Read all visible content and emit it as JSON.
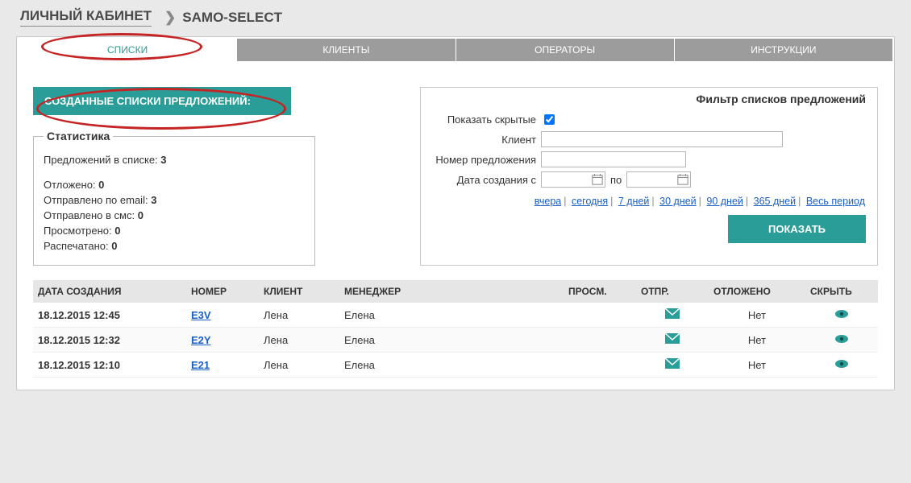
{
  "breadcrumb": {
    "home": "ЛИЧНЫЙ КАБИНЕТ",
    "current": "SAMO-SELECT"
  },
  "tabs": [
    "СПИСКИ",
    "КЛИЕНТЫ",
    "ОПЕРАТОРЫ",
    "ИНСТРУКЦИИ"
  ],
  "panel_title": "СОЗДАННЫЕ СПИСКИ ПРЕДЛОЖЕНИЙ:",
  "stats": {
    "legend": "Статистика",
    "lines": [
      {
        "label": "Предложений в списке:",
        "value": "3"
      },
      {
        "label": "Отложено:",
        "value": "0"
      },
      {
        "label": "Отправлено по email:",
        "value": "3"
      },
      {
        "label": "Отправлено в смс:",
        "value": "0"
      },
      {
        "label": "Просмотрено:",
        "value": "0"
      },
      {
        "label": "Распечатано:",
        "value": "0"
      }
    ]
  },
  "filter": {
    "title": "Фильтр списков предложений",
    "show_hidden_label": "Показать скрытые",
    "client_label": "Клиент",
    "offer_number_label": "Номер предложения",
    "date_from_label": "Дата создания с",
    "date_to_label": "по",
    "quick": [
      "вчера",
      "сегодня",
      "7 дней",
      "30 дней",
      "90 дней",
      "365 дней",
      "Весь период"
    ],
    "show_button": "ПОКАЗАТЬ"
  },
  "table": {
    "headers": [
      "ДАТА СОЗДАНИЯ",
      "НОМЕР",
      "КЛИЕНТ",
      "МЕНЕДЖЕР",
      "ПРОСМ.",
      "ОТПР.",
      "ОТЛОЖЕНО",
      "СКРЫТЬ"
    ],
    "rows": [
      {
        "date": "18.12.2015 12:45",
        "code": "E3V",
        "client": "Лена",
        "manager": "Елена",
        "viewed": "",
        "sent": "mail",
        "deferred": "Нет"
      },
      {
        "date": "18.12.2015 12:32",
        "code": "E2Y",
        "client": "Лена",
        "manager": "Елена",
        "viewed": "",
        "sent": "mail",
        "deferred": "Нет"
      },
      {
        "date": "18.12.2015 12:10",
        "code": "E21",
        "client": "Лена",
        "manager": "Елена",
        "viewed": "",
        "sent": "mail",
        "deferred": "Нет"
      }
    ]
  }
}
